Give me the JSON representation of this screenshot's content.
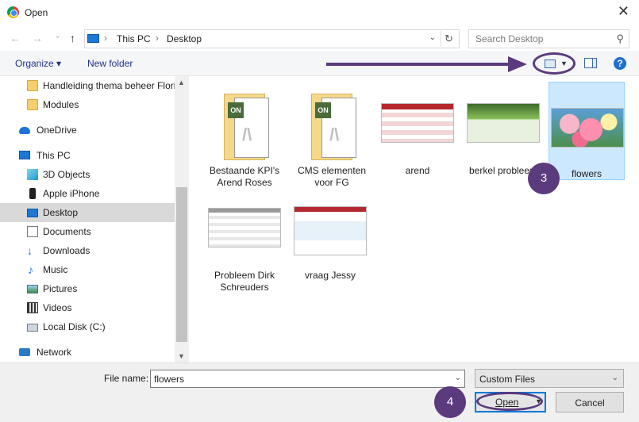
{
  "window": {
    "title": "Open",
    "close_glyph": "✕"
  },
  "nav": {
    "back": "←",
    "forward": "→",
    "recent": "⌄",
    "up": "↑"
  },
  "address": {
    "crumbs": [
      "This PC",
      "Desktop"
    ],
    "separator": "›",
    "dropdown": "⌄",
    "refresh": "↻"
  },
  "search": {
    "placeholder": "Search Desktop",
    "icon": "⚲"
  },
  "toolbar": {
    "organize": "Organize ▾",
    "new_folder": "New folder",
    "help": "?"
  },
  "sidebar": {
    "items": [
      {
        "label": "Handleiding thema beheer Flori",
        "icon": "folder-icon"
      },
      {
        "label": "Modules",
        "icon": "folder-icon"
      },
      {
        "label": "OneDrive",
        "icon": "cloud-icon"
      },
      {
        "label": "This PC",
        "icon": "computer-icon"
      },
      {
        "label": "3D Objects",
        "icon": "cube-icon"
      },
      {
        "label": "Apple iPhone",
        "icon": "phone-icon"
      },
      {
        "label": "Desktop",
        "icon": "desktop-icon",
        "selected": true
      },
      {
        "label": "Documents",
        "icon": "document-icon"
      },
      {
        "label": "Downloads",
        "icon": "download-icon"
      },
      {
        "label": "Music",
        "icon": "music-icon"
      },
      {
        "label": "Pictures",
        "icon": "pictures-icon"
      },
      {
        "label": "Videos",
        "icon": "videos-icon"
      },
      {
        "label": "Local Disk (C:)",
        "icon": "disk-icon"
      },
      {
        "label": "Network",
        "icon": "network-icon"
      }
    ]
  },
  "files": [
    {
      "name": "Bestaande KPI's Arend Roses",
      "type": "document"
    },
    {
      "name": "CMS elementen voor FG",
      "type": "document"
    },
    {
      "name": "arend",
      "type": "image"
    },
    {
      "name": "berkel probleem",
      "type": "image"
    },
    {
      "name": "flowers",
      "type": "image",
      "selected": true
    },
    {
      "name": "Probleem Dirk Schreuders",
      "type": "image"
    },
    {
      "name": "vraag Jessy",
      "type": "image"
    }
  ],
  "annotations": {
    "step3": "3",
    "step4": "4",
    "color": "#5b3a7e"
  },
  "footer": {
    "file_name_label": "File name:",
    "file_name_value": "flowers",
    "file_type": "Custom Files",
    "open": "Open",
    "cancel": "Cancel"
  }
}
